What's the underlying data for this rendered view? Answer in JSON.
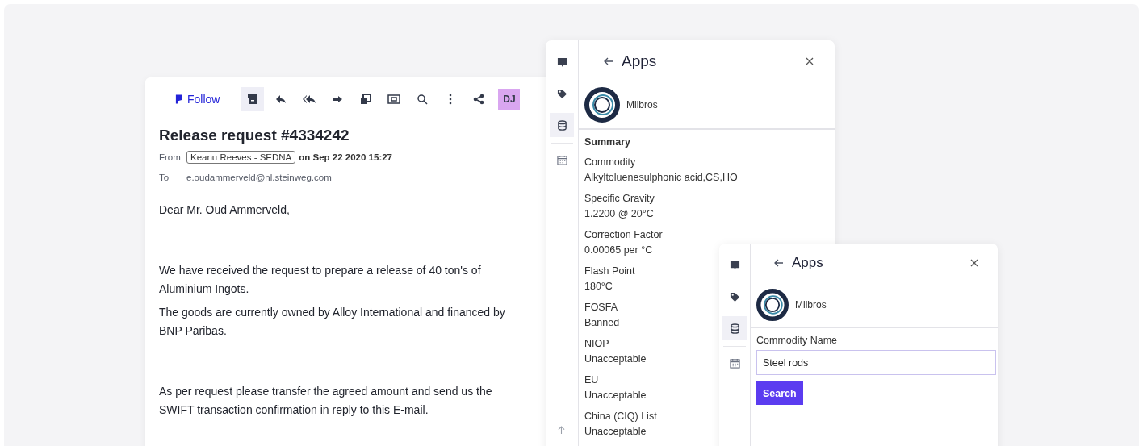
{
  "email": {
    "follow": "Follow",
    "toolbar": [
      {
        "kind": "archive",
        "selected": true
      },
      {
        "kind": "reply",
        "selected": false
      },
      {
        "kind": "reply-all",
        "selected": false
      },
      {
        "kind": "forward",
        "selected": false
      },
      {
        "kind": "copy",
        "selected": false
      },
      {
        "kind": "screen",
        "selected": false
      },
      {
        "kind": "search",
        "selected": false
      },
      {
        "kind": "more",
        "selected": false
      },
      {
        "kind": "share",
        "selected": false
      }
    ],
    "avatar": "DJ",
    "title": "Release request #4334242",
    "from_label": "From",
    "sender": "Keanu Reeves - SEDNA",
    "date": "on Sep 22 2020 15:27",
    "to_label": "To",
    "recipient": "e.oudammerveld@nl.steinweg.com",
    "body": [
      {
        "lines": [
          "Dear Mr. Oud Ammerveld,"
        ]
      },
      {
        "lines": [
          "We have received the request to prepare a release of 40 ton's of",
          "Aluminium Ingots."
        ]
      },
      {
        "lines": [
          "The goods are currently owned by Alloy International and financed by",
          "BNP Paribas."
        ]
      },
      {
        "lines": [
          "As per request please transfer the agreed amount and send us the",
          "SWIFT transaction confirmation in reply to this E-mail."
        ]
      }
    ]
  },
  "panel": {
    "rail": [
      {
        "kind": "chat",
        "selected": false
      },
      {
        "kind": "tag",
        "selected": false
      },
      {
        "kind": "database",
        "selected": true
      },
      {
        "kind": "calendar",
        "selected": false
      }
    ],
    "title": "Apps",
    "app_name": "Milbros",
    "section": "Summary",
    "fields": [
      {
        "label": "Commodity",
        "value": "Alkyltoluenesulphonic acid,CS,HO"
      },
      {
        "label": "Specific Gravity",
        "value": "1.2200 @ 20°C"
      },
      {
        "label": "Correction Factor",
        "value": "0.00065 per °C"
      },
      {
        "label": "Flash Point",
        "value": "180°C"
      },
      {
        "label": "FOSFA",
        "value": "Banned"
      },
      {
        "label": "NIOP",
        "value": "Unacceptable"
      },
      {
        "label": "EU",
        "value": "Unacceptable"
      },
      {
        "label": "China (CIQ) List",
        "value": "Unacceptable"
      }
    ]
  },
  "search_panel": {
    "rail": [
      {
        "kind": "chat",
        "selected": false
      },
      {
        "kind": "tag",
        "selected": false
      },
      {
        "kind": "database",
        "selected": true
      },
      {
        "kind": "calendar",
        "selected": false
      }
    ],
    "title": "Apps",
    "app_name": "Milbros",
    "field_label": "Commodity Name",
    "field_value": "Steel rods",
    "button": "Search"
  }
}
